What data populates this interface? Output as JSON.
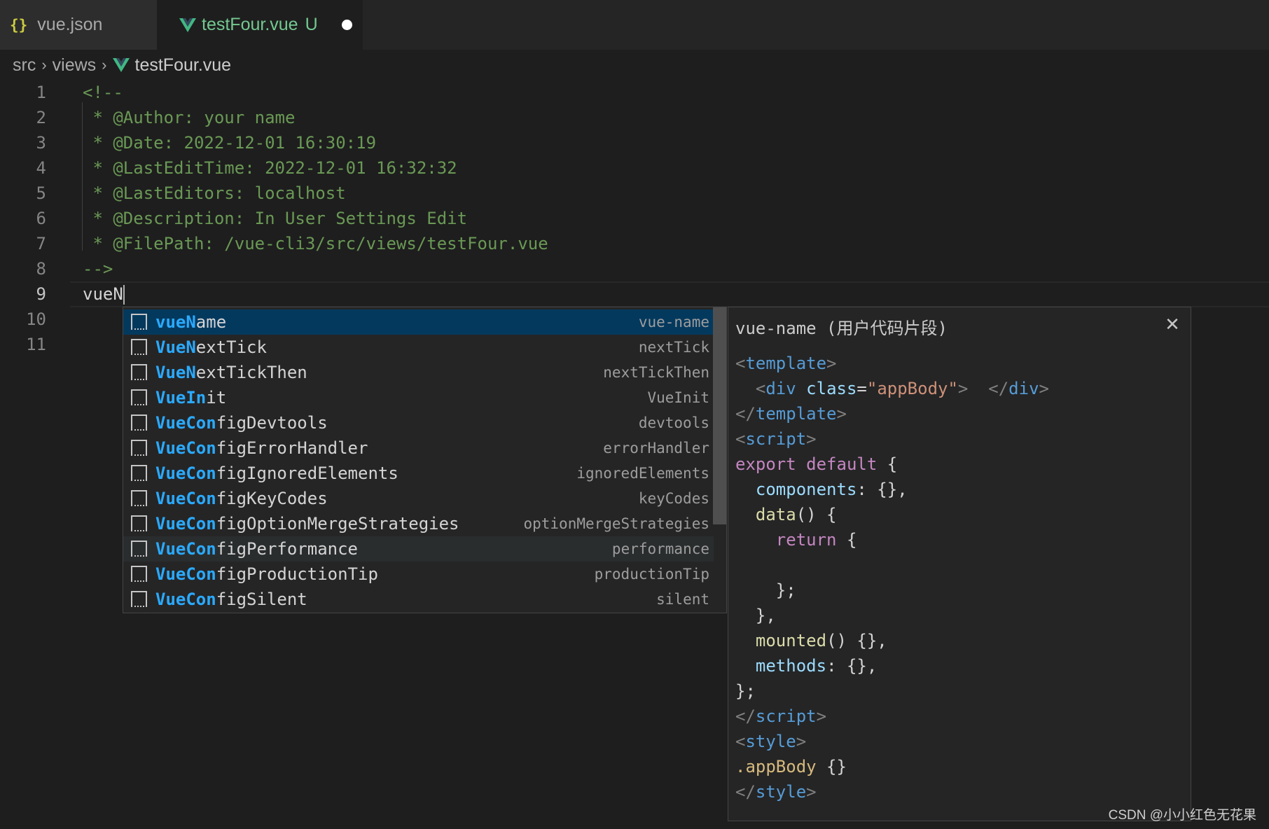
{
  "tabs": [
    {
      "icon": "{}",
      "label": "vue.json"
    },
    {
      "label": "testFour.vue",
      "status": "U"
    }
  ],
  "breadcrumb": [
    "src",
    "views",
    "testFour.vue"
  ],
  "editor": {
    "lines": [
      {
        "num": "1",
        "text": "<!--"
      },
      {
        "num": "2",
        "text": " * @Author: your name"
      },
      {
        "num": "3",
        "text": " * @Date: 2022-12-01 16:30:19"
      },
      {
        "num": "4",
        "text": " * @LastEditTime: 2022-12-01 16:32:32"
      },
      {
        "num": "5",
        "text": " * @LastEditors: localhost"
      },
      {
        "num": "6",
        "text": " * @Description: In User Settings Edit"
      },
      {
        "num": "7",
        "text": " * @FilePath: /vue-cli3/src/views/testFour.vue"
      },
      {
        "num": "8",
        "text": "-->"
      },
      {
        "num": "9",
        "text": "vueN"
      },
      {
        "num": "10",
        "text": ""
      },
      {
        "num": "11",
        "text": ""
      }
    ]
  },
  "suggestions": [
    {
      "match": "vueN",
      "rest": "ame",
      "detail": "vue-name",
      "state": "selected"
    },
    {
      "match": "VueN",
      "rest": "extTick",
      "detail": "nextTick"
    },
    {
      "match": "VueN",
      "rest": "extTickThen",
      "detail": "nextTickThen"
    },
    {
      "match": "VueIn",
      "rest": "it",
      "detail": "VueInit"
    },
    {
      "match": "VueCon",
      "rest": "figDevtools",
      "detail": "devtools"
    },
    {
      "match": "VueCon",
      "rest": "figErrorHandler",
      "detail": "errorHandler"
    },
    {
      "match": "VueCon",
      "rest": "figIgnoredElements",
      "detail": "ignoredElements"
    },
    {
      "match": "VueCon",
      "rest": "figKeyCodes",
      "detail": "keyCodes"
    },
    {
      "match": "VueCon",
      "rest": "figOptionMergeStrategies",
      "detail": "optionMergeStrategies"
    },
    {
      "match": "VueCon",
      "rest": "figPerformance",
      "detail": "performance",
      "state": "hover"
    },
    {
      "match": "VueCon",
      "rest": "figProductionTip",
      "detail": "productionTip"
    },
    {
      "match": "VueCon",
      "rest": "figSilent",
      "detail": "silent"
    }
  ],
  "details": {
    "title": "vue-name (用户代码片段)",
    "close_icon": "close-icon",
    "code_lines": [
      [
        [
          "<",
          "punc"
        ],
        [
          "template",
          "tag"
        ],
        [
          ">",
          "punc"
        ]
      ],
      [
        [
          "  <",
          "punc"
        ],
        [
          "div",
          "tag"
        ],
        [
          " ",
          "txt"
        ],
        [
          "class",
          "attr"
        ],
        [
          "=",
          "txt"
        ],
        [
          "\"appBody\"",
          "str"
        ],
        [
          ">",
          "punc"
        ],
        [
          "  </",
          "punc"
        ],
        [
          "div",
          "tag"
        ],
        [
          ">",
          "punc"
        ]
      ],
      [
        [
          "</",
          "punc"
        ],
        [
          "template",
          "tag"
        ],
        [
          ">",
          "punc"
        ]
      ],
      [
        [
          "<",
          "punc"
        ],
        [
          "script",
          "tag"
        ],
        [
          ">",
          "punc"
        ]
      ],
      [
        [
          "export",
          "kw"
        ],
        [
          " ",
          "txt"
        ],
        [
          "default",
          "kw"
        ],
        [
          " {",
          "txt"
        ]
      ],
      [
        [
          "  ",
          "txt"
        ],
        [
          "components",
          "attr"
        ],
        [
          ": {},",
          "txt"
        ]
      ],
      [
        [
          "  ",
          "txt"
        ],
        [
          "data",
          "fn"
        ],
        [
          "() {",
          "txt"
        ]
      ],
      [
        [
          "    ",
          "txt"
        ],
        [
          "return",
          "kw"
        ],
        [
          " {",
          "txt"
        ]
      ],
      [
        [
          "",
          "txt"
        ]
      ],
      [
        [
          "    };",
          "txt"
        ]
      ],
      [
        [
          "  },",
          "txt"
        ]
      ],
      [
        [
          "  ",
          "txt"
        ],
        [
          "mounted",
          "fn"
        ],
        [
          "() {},",
          "txt"
        ]
      ],
      [
        [
          "  ",
          "txt"
        ],
        [
          "methods",
          "attr"
        ],
        [
          ": {},",
          "txt"
        ]
      ],
      [
        [
          "};",
          "txt"
        ]
      ],
      [
        [
          "</",
          "punc"
        ],
        [
          "script",
          "tag"
        ],
        [
          ">",
          "punc"
        ]
      ],
      [
        [
          "<",
          "punc"
        ],
        [
          "style",
          "tag"
        ],
        [
          ">",
          "punc"
        ]
      ],
      [
        [
          ".appBody",
          "cls"
        ],
        [
          " {}",
          "txt"
        ]
      ],
      [
        [
          "</",
          "punc"
        ],
        [
          "style",
          "tag"
        ],
        [
          ">",
          "punc"
        ]
      ]
    ]
  },
  "watermark": "CSDN @小小红色无花果",
  "colors": {
    "accent": "#04395e",
    "match": "#2aaaff",
    "modified": "#73c991",
    "comment": "#6a9955"
  }
}
